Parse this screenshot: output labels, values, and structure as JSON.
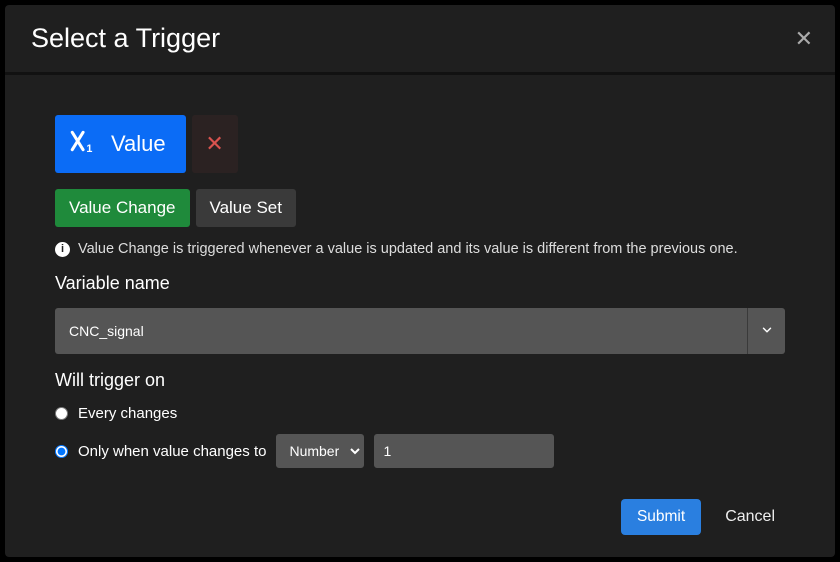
{
  "header": {
    "title": "Select a Trigger"
  },
  "chip": {
    "label": "Value"
  },
  "tabs": {
    "change": "Value Change",
    "set": "Value Set"
  },
  "helper": "Value Change is triggered whenever a value is updated and its value is different from the previous one.",
  "variable": {
    "label": "Variable name",
    "value": "CNC_signal"
  },
  "trigger_on": {
    "label": "Will trigger on",
    "every": "Every changes",
    "only": "Only when value changes to",
    "selected": "only",
    "type": "Number",
    "value": "1"
  },
  "footer": {
    "submit": "Submit",
    "cancel": "Cancel"
  }
}
